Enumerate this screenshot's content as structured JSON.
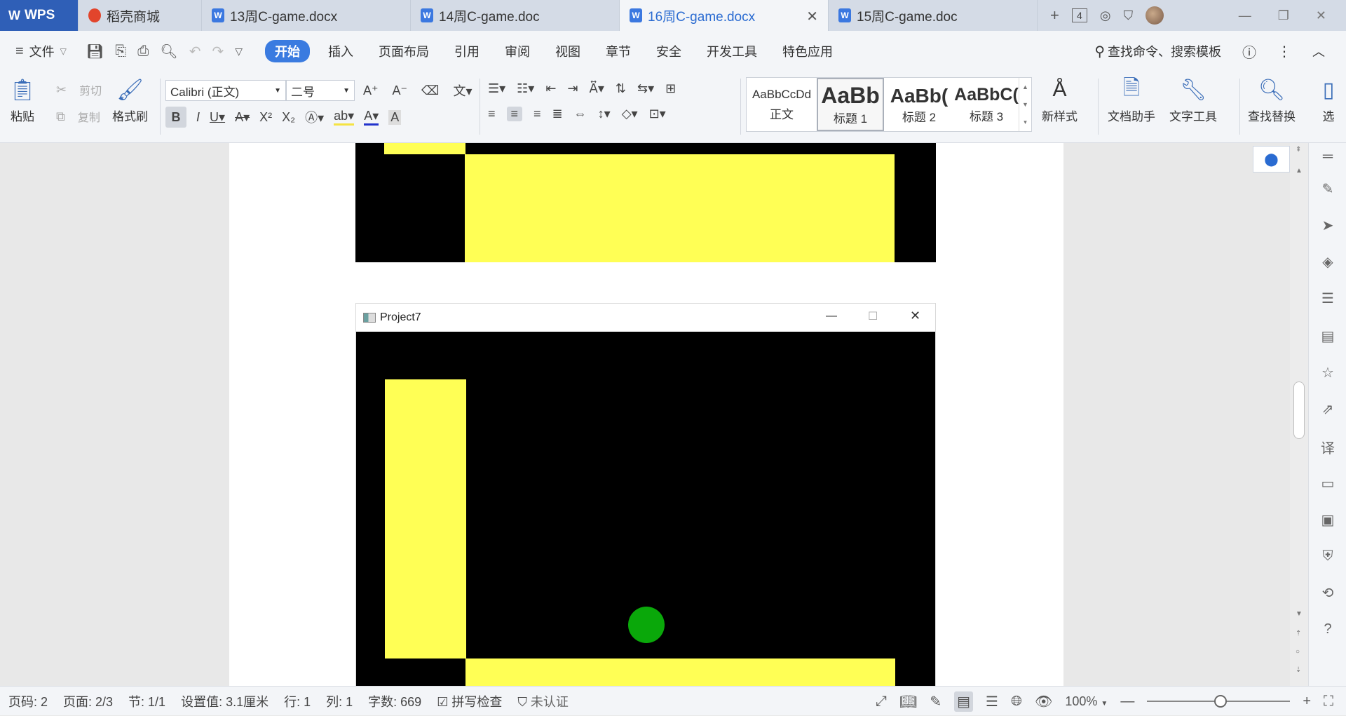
{
  "tabs": {
    "wps": "WPS",
    "store": "稻壳商城",
    "docs": [
      {
        "title": "13周C-game.docx",
        "active": false
      },
      {
        "title": "14周C-game.doc",
        "active": false
      },
      {
        "title": "16周C-game.docx",
        "active": true
      },
      {
        "title": "15周C-game.doc",
        "active": false
      }
    ],
    "add": "+",
    "count": "4"
  },
  "menubar": {
    "file": "文件",
    "items": [
      "开始",
      "插入",
      "页面布局",
      "引用",
      "审阅",
      "视图",
      "章节",
      "安全",
      "开发工具",
      "特色应用"
    ],
    "active_index": 0,
    "search": "查找命令、搜索模板"
  },
  "ribbon": {
    "paste": "粘贴",
    "cut": "剪切",
    "copy": "复制",
    "format_painter": "格式刷",
    "font": "Calibri (正文)",
    "size": "二号",
    "styles": [
      {
        "sample": "AaBbCcDd",
        "label": "正文"
      },
      {
        "sample": "AaBb",
        "label": "标题 1"
      },
      {
        "sample": "AaBb(",
        "label": "标题 2"
      },
      {
        "sample": "AaBbC(",
        "label": "标题 3"
      }
    ],
    "new_style": "新样式",
    "doc_assistant": "文档助手",
    "text_tools": "文字工具",
    "find_replace": "查找替换",
    "select": "选"
  },
  "document": {
    "window_title": "Project7",
    "colors": {
      "background": "#000000",
      "wall": "#ffff55",
      "ball": "#0aa80a"
    }
  },
  "statusbar": {
    "page_code": "页码: 2",
    "page": "页面: 2/3",
    "section": "节: 1/1",
    "setting": "设置值: 3.1厘米",
    "row": "行: 1",
    "col": "列: 1",
    "word_count": "字数: 669",
    "spell_check": "拼写检查",
    "auth": "未认证",
    "zoom": "100%"
  }
}
